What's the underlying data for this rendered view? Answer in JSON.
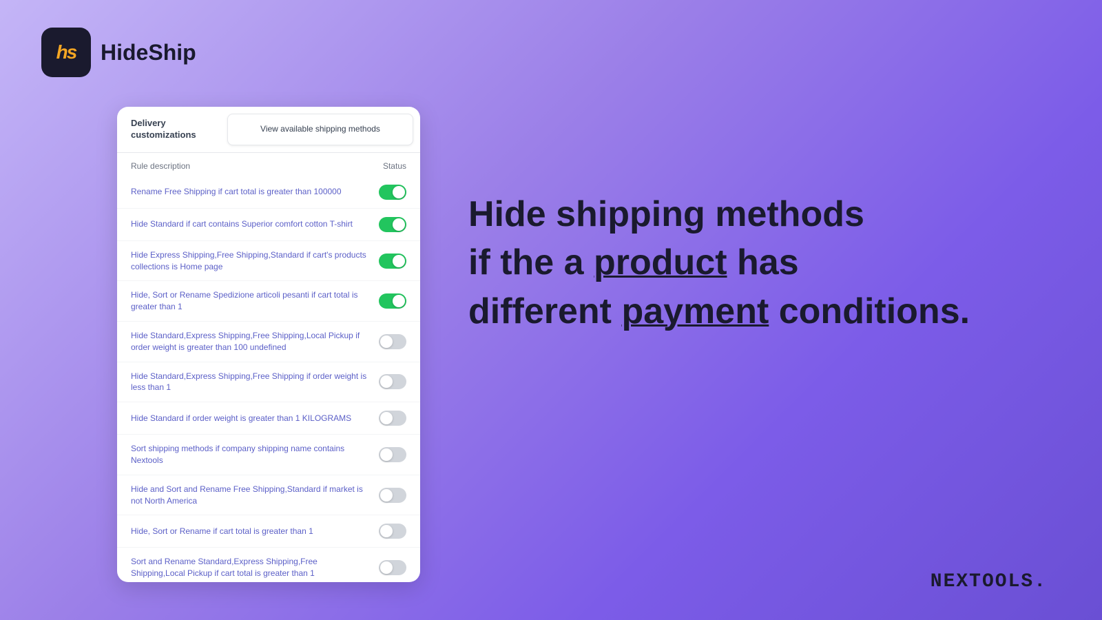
{
  "app": {
    "logo_text": "hs",
    "name": "HideShip"
  },
  "card": {
    "tab_left": "Delivery customizations",
    "tab_right": "View available shipping methods",
    "table_col1": "Rule description",
    "table_col2": "Status"
  },
  "rules": [
    {
      "id": 1,
      "text": "Rename Free Shipping if cart total is greater than 100000",
      "enabled": true
    },
    {
      "id": 2,
      "text": "Hide Standard if cart contains Superior comfort cotton T-shirt",
      "enabled": true
    },
    {
      "id": 3,
      "text": "Hide Express Shipping,Free Shipping,Standard if cart's products collections is Home page",
      "enabled": true
    },
    {
      "id": 4,
      "text": "Hide, Sort or Rename Spedizione articoli pesanti if cart total is greater than 1",
      "enabled": true
    },
    {
      "id": 5,
      "text": "Hide Standard,Express Shipping,Free Shipping,Local Pickup if order weight is greater than 100 undefined",
      "enabled": false
    },
    {
      "id": 6,
      "text": "Hide Standard,Express Shipping,Free Shipping if order weight is less than 1",
      "enabled": false
    },
    {
      "id": 7,
      "text": "Hide Standard if order weight is greater than 1 KILOGRAMS",
      "enabled": false
    },
    {
      "id": 8,
      "text": "Sort shipping methods if company shipping name contains Nextools",
      "enabled": false
    },
    {
      "id": 9,
      "text": "Hide and Sort and Rename Free Shipping,Standard if market is not North America",
      "enabled": false
    },
    {
      "id": 10,
      "text": "Hide, Sort or Rename if cart total is greater than 1",
      "enabled": false
    },
    {
      "id": 11,
      "text": "Sort and Rename Standard,Express Shipping,Free Shipping,Local Pickup if cart total is greater than 1",
      "enabled": false
    }
  ],
  "hero": {
    "line1": "Hide shipping methods",
    "line2_prefix": "if the a ",
    "line2_keyword": "product",
    "line2_suffix": " has",
    "line3_prefix": "different ",
    "line3_keyword": "payment",
    "line3_suffix": " conditions."
  },
  "nextools": {
    "text": "NEXTOOLS."
  }
}
